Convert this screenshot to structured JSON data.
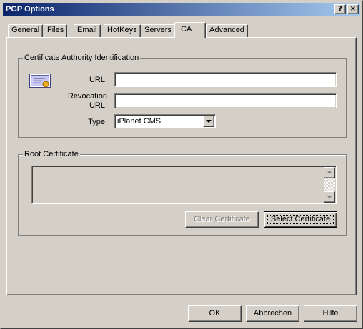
{
  "window": {
    "title": "PGP Options",
    "help_btn": "?",
    "close_btn": "×"
  },
  "tabs": [
    {
      "label": "General"
    },
    {
      "label": "Files"
    },
    {
      "label": "Email"
    },
    {
      "label": "HotKeys"
    },
    {
      "label": "Servers"
    },
    {
      "label": "CA",
      "active": true
    },
    {
      "label": "Advanced"
    }
  ],
  "ca_group": {
    "title": "Certificate Authority Identification",
    "icon": "certificate-icon",
    "url_label": "URL:",
    "url_value": "",
    "revocation_label_line1": "Revocation",
    "revocation_label_line2": "URL:",
    "revocation_value": "",
    "type_label": "Type:",
    "type_value": "iPlanet CMS"
  },
  "root_group": {
    "title": "Root Certificate",
    "certificate_text": "",
    "clear_label": "Clear Certificate",
    "select_label": "Select Certificate"
  },
  "footer": {
    "ok_label": "OK",
    "cancel_label": "Abbrechen",
    "help_label": "Hilfe"
  },
  "colors": {
    "face": "#d4d0c8",
    "title_start": "#0a246a",
    "title_end": "#a6caf0"
  }
}
